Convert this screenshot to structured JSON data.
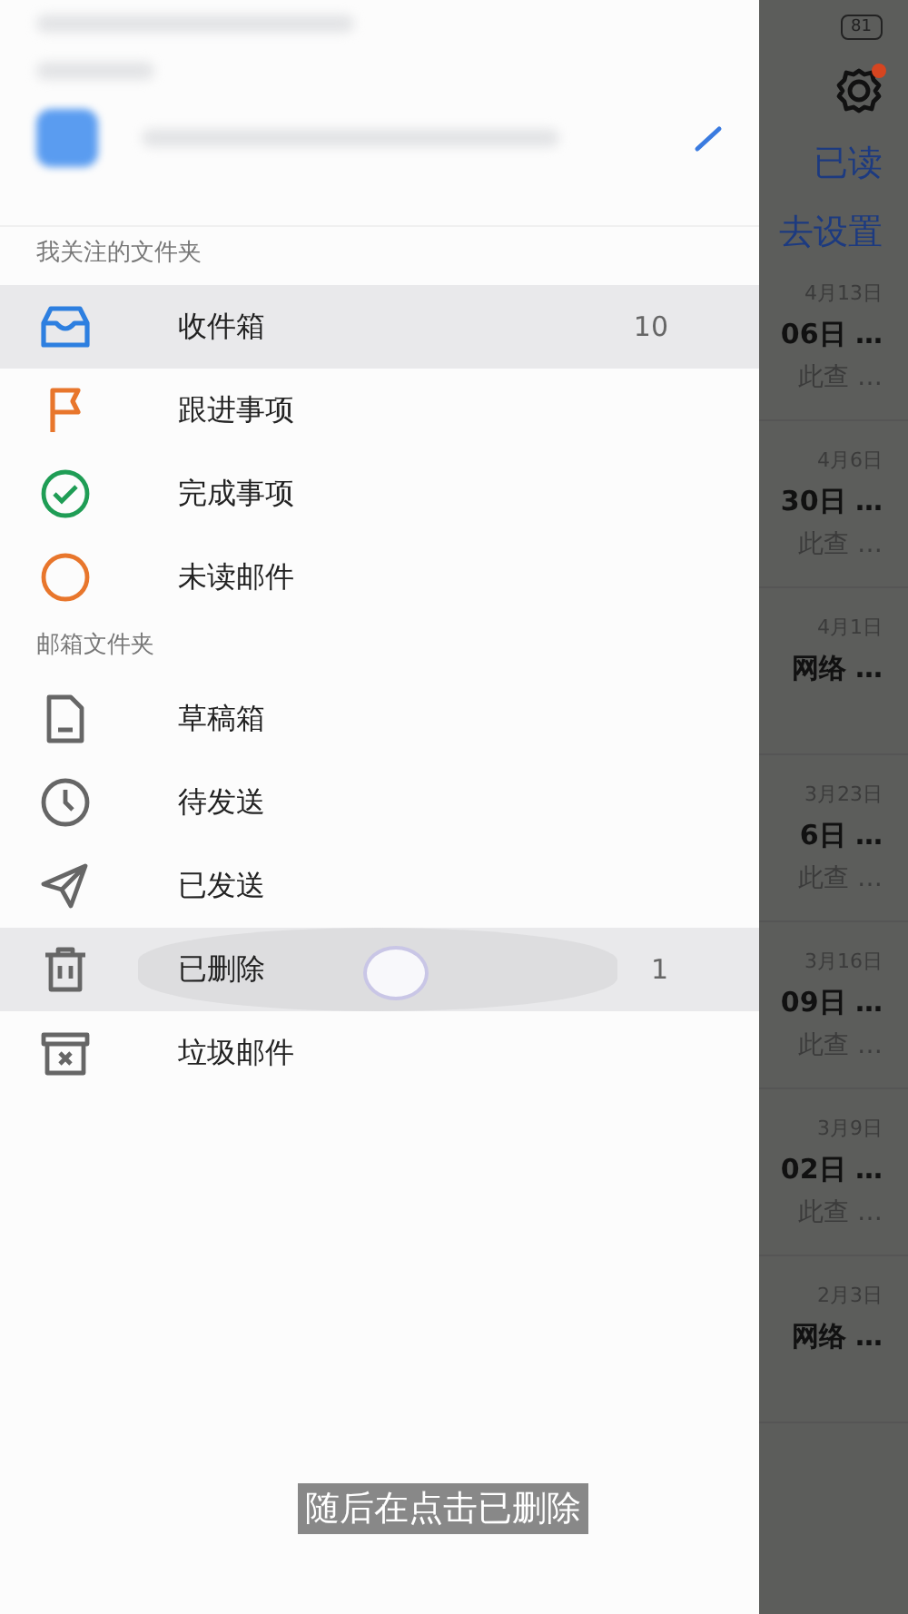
{
  "status_bar": {
    "battery": "81"
  },
  "background": {
    "actions": [
      "已读",
      "去设置"
    ],
    "mails": [
      {
        "date": "4月13日",
        "line_1": "06日 …",
        "line_2": "此查 …"
      },
      {
        "date": "4月6日",
        "line_1": "30日 …",
        "line_2": "此查 …"
      },
      {
        "date": "4月1日",
        "line_1": "网络 …"
      },
      {
        "date": "3月23日",
        "line_1": "6日 …",
        "line_2": "此查 …"
      },
      {
        "date": "3月16日",
        "line_1": "09日 …",
        "line_2": "此查 …"
      },
      {
        "date": "3月9日",
        "line_1": "02日 …",
        "line_2": "此查 …"
      },
      {
        "date": "2月3日",
        "line_1": "网络 …"
      }
    ]
  },
  "drawer": {
    "sections": [
      {
        "title": "我关注的文件夹",
        "items": [
          {
            "label": "收件箱",
            "count": "10",
            "selected": true,
            "pressed": false
          },
          {
            "label": "跟进事项",
            "selected": false,
            "pressed": false
          },
          {
            "label": "完成事项",
            "selected": false,
            "pressed": false
          },
          {
            "label": "未读邮件",
            "selected": false,
            "pressed": false
          }
        ]
      },
      {
        "title": "邮箱文件夹",
        "items": [
          {
            "label": "草稿箱",
            "selected": false,
            "pressed": false
          },
          {
            "label": "待发送",
            "selected": false,
            "pressed": false
          },
          {
            "label": "已发送",
            "selected": false,
            "pressed": false
          },
          {
            "label": "已删除",
            "count": "1",
            "selected": true,
            "pressed": true
          },
          {
            "label": "垃圾邮件",
            "selected": false,
            "pressed": false
          }
        ]
      }
    ]
  },
  "caption": "随后在点击已删除"
}
